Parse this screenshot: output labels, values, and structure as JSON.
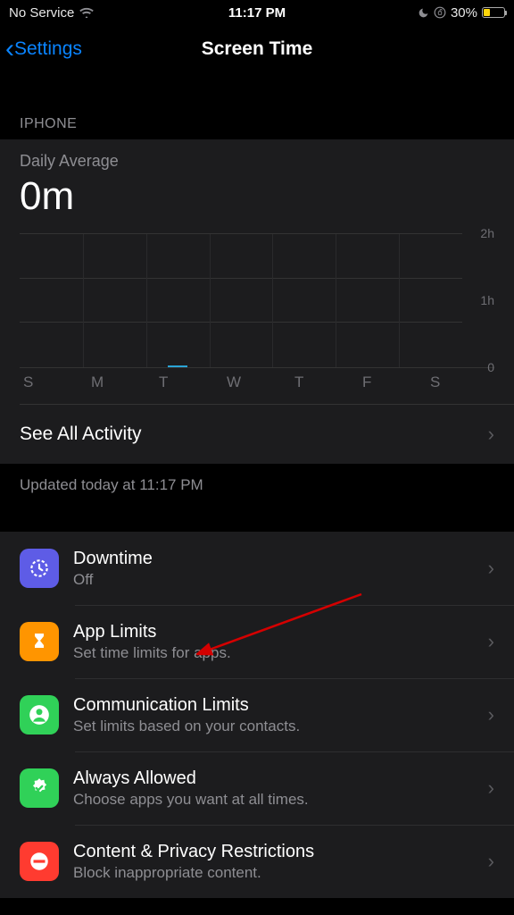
{
  "status_bar": {
    "carrier": "No Service",
    "time": "11:17 PM",
    "battery_pct": "30%"
  },
  "nav": {
    "back_label": "Settings",
    "title": "Screen Time"
  },
  "section_header": "IPHONE",
  "daily_average": {
    "label": "Daily Average",
    "value": "0m"
  },
  "chart_data": {
    "type": "bar",
    "categories": [
      "S",
      "M",
      "T",
      "W",
      "T",
      "F",
      "S"
    ],
    "values": [
      0,
      0,
      0.02,
      0,
      0,
      0,
      0
    ],
    "ylabels": [
      "2h",
      "1h",
      "0"
    ],
    "ylim": [
      0,
      2
    ],
    "ylabel": "hours",
    "xlabel": "",
    "title": "Daily Average"
  },
  "see_all": "See All Activity",
  "updated": "Updated today at 11:17 PM",
  "rows": [
    {
      "title": "Downtime",
      "subtitle": "Off",
      "icon": "downtime-icon",
      "color": "ic-purple"
    },
    {
      "title": "App Limits",
      "subtitle": "Set time limits for apps.",
      "icon": "hourglass-icon",
      "color": "ic-orange"
    },
    {
      "title": "Communication Limits",
      "subtitle": "Set limits based on your contacts.",
      "icon": "contact-icon",
      "color": "ic-green"
    },
    {
      "title": "Always Allowed",
      "subtitle": "Choose apps you want at all times.",
      "icon": "check-seal-icon",
      "color": "ic-green2"
    },
    {
      "title": "Content & Privacy Restrictions",
      "subtitle": "Block inappropriate content.",
      "icon": "no-entry-icon",
      "color": "ic-red"
    }
  ]
}
